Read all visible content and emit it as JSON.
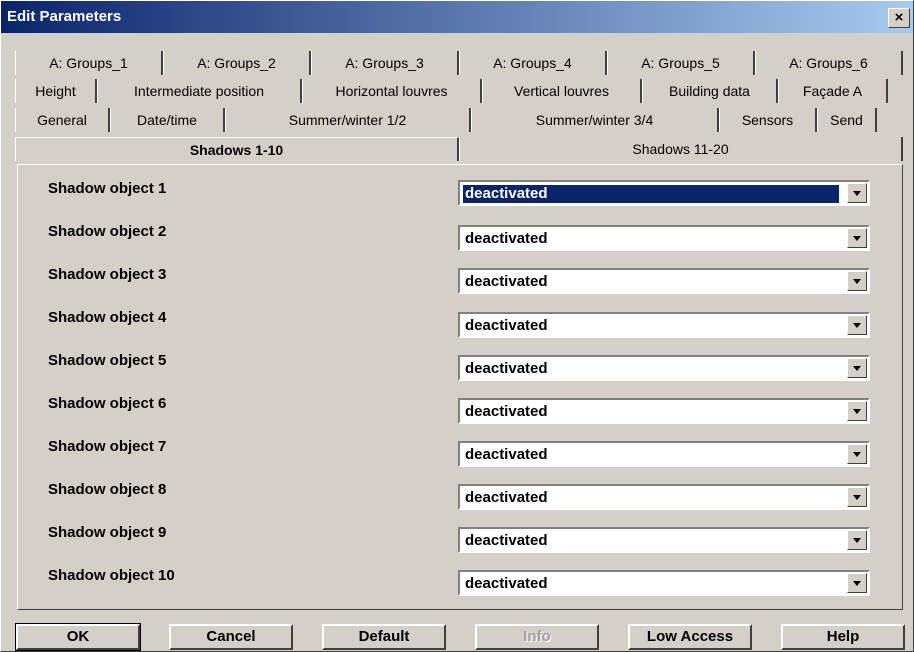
{
  "window": {
    "title": "Edit Parameters",
    "close_glyph": "×"
  },
  "tabs": {
    "row1": [
      "A: Groups_1",
      "A: Groups_2",
      "A: Groups_3",
      "A: Groups_4",
      "A: Groups_5",
      "A: Groups_6"
    ],
    "row2": [
      "Height",
      "Intermediate position",
      "Horizontal louvres",
      "Vertical louvres",
      "Building data",
      "Façade A"
    ],
    "row3": [
      "General",
      "Date/time",
      "Summer/winter 1/2",
      "Summer/winter 3/4",
      "Sensors",
      "Send"
    ],
    "row4": [
      "Shadows 1-10",
      "Shadows 11-20"
    ],
    "active": "Shadows 1-10"
  },
  "shadows": {
    "rows": [
      {
        "label": "Shadow object 1",
        "value": "deactivated",
        "selected": true
      },
      {
        "label": "Shadow object 2",
        "value": "deactivated"
      },
      {
        "label": "Shadow object 3",
        "value": "deactivated"
      },
      {
        "label": "Shadow object 4",
        "value": "deactivated"
      },
      {
        "label": "Shadow object 5",
        "value": "deactivated"
      },
      {
        "label": "Shadow object 6",
        "value": "deactivated"
      },
      {
        "label": "Shadow object 7",
        "value": "deactivated"
      },
      {
        "label": "Shadow object 8",
        "value": "deactivated"
      },
      {
        "label": "Shadow object 9",
        "value": "deactivated"
      },
      {
        "label": "Shadow object 10",
        "value": "deactivated"
      }
    ]
  },
  "buttons": {
    "ok": "OK",
    "cancel": "Cancel",
    "default": "Default",
    "info": "Info",
    "low_access": "Low Access",
    "help": "Help"
  }
}
